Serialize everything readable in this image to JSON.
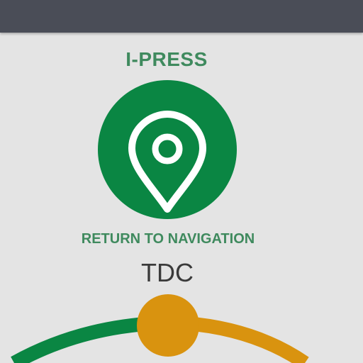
{
  "app": {
    "title": "I-PRESS"
  },
  "navigation": {
    "label": "RETURN TO NAVIGATION",
    "icon": "map-pin-icon"
  },
  "gauge": {
    "label": "TDC",
    "colors": {
      "left_arc": "#0a8643",
      "right_arc": "#d9930f",
      "handle": "#d9930f"
    }
  },
  "colors": {
    "top_bar": "#4a4d57",
    "background": "#e4e4e4",
    "accent_green": "#0a8643",
    "text_green": "#3f8a5e",
    "accent_orange": "#d9930f"
  }
}
